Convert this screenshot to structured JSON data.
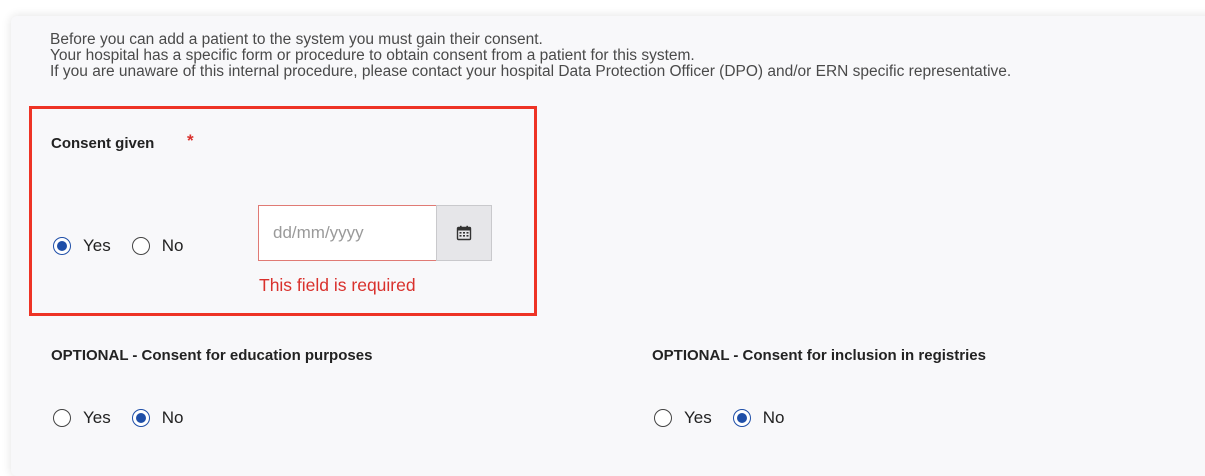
{
  "intro": {
    "line1": "Before you can add a patient to the system you must gain their consent.",
    "line2": "Your hospital has a specific form or procedure to obtain consent from a patient for this system.",
    "line3": "If you are unaware of this internal procedure, please contact your hospital Data Protection Officer (DPO) and/or ERN specific representative."
  },
  "consent": {
    "label": "Consent given",
    "required_marker": "*",
    "yes_label": "Yes",
    "no_label": "No",
    "selected": "Yes",
    "date_placeholder": "dd/mm/yyyy",
    "date_value": "",
    "error": "This field is required"
  },
  "education": {
    "label": "OPTIONAL - Consent for education purposes",
    "yes_label": "Yes",
    "no_label": "No",
    "selected": "No"
  },
  "registries": {
    "label": "OPTIONAL - Consent for inclusion in registries",
    "yes_label": "Yes",
    "no_label": "No",
    "selected": "No"
  },
  "colors": {
    "accent": "#1f4fa8",
    "error": "#d9302c",
    "highlight": "#ee3325"
  },
  "icons": {
    "calendar": "calendar-icon"
  }
}
